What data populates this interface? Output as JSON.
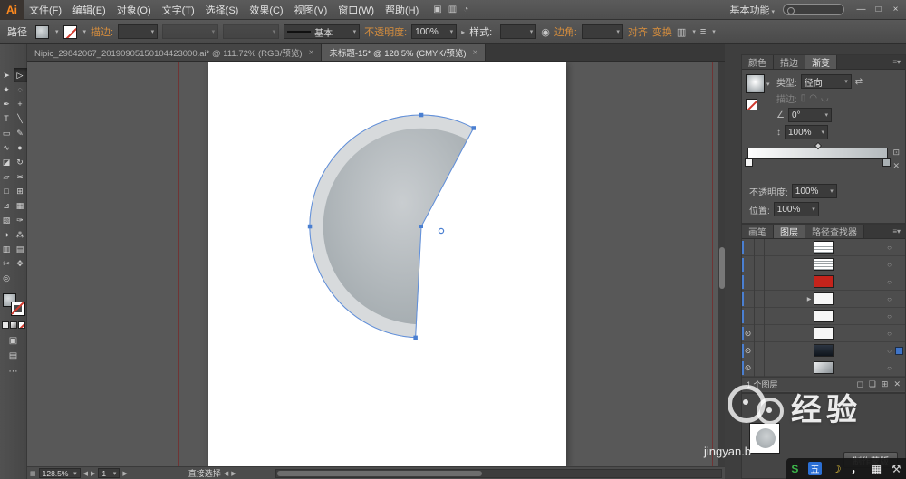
{
  "colors": {
    "accent_link": "#d78e3d",
    "selection_blue": "#4a7fd1",
    "artboard": "#ffffff"
  },
  "window": {
    "controls": [
      {
        "name": "minimize-button",
        "glyph": "—"
      },
      {
        "name": "restore-button",
        "glyph": "□"
      },
      {
        "name": "close-button",
        "glyph": "×"
      }
    ]
  },
  "menubar": {
    "logo": "Ai",
    "items": [
      "文件(F)",
      "编辑(E)",
      "对象(O)",
      "文字(T)",
      "选择(S)",
      "效果(C)",
      "视图(V)",
      "窗口(W)",
      "帮助(H)"
    ],
    "icons": [
      {
        "name": "bridge-icon",
        "glyph": "▣"
      },
      {
        "name": "arrange-documents-icon",
        "glyph": "▥"
      },
      {
        "name": "cs-live-icon",
        "glyph": "◔"
      }
    ],
    "workspace": "基本功能"
  },
  "controlbar": {
    "selection_label": "路径",
    "stroke_link": "描边:",
    "stroke_style": "基本",
    "opacity_link": "不透明度:",
    "opacity_value": "100%",
    "style_label": "样式:",
    "corner_link": "边角:",
    "align_link": "对齐",
    "transform_link": "变换"
  },
  "doc_tabs": [
    {
      "label": "Nipic_29842067_20190905150104423000.ai* @ 111.72% (RGB/预览)",
      "close": "×",
      "active": false
    },
    {
      "label": "未标题-15* @ 128.5% (CMYK/预览)",
      "close": "×",
      "active": true
    }
  ],
  "toolbar": {
    "tools": [
      {
        "name": "selection-tool",
        "glyph": "➤"
      },
      {
        "name": "direct-selection-tool",
        "glyph": "▷",
        "active": true
      },
      {
        "name": "magic-wand-tool",
        "glyph": "✦"
      },
      {
        "name": "lasso-tool",
        "glyph": "◌"
      },
      {
        "name": "pen-tool",
        "glyph": "✒"
      },
      {
        "name": "anchor-point-tool",
        "glyph": "+"
      },
      {
        "name": "type-tool",
        "glyph": "T"
      },
      {
        "name": "line-segment-tool",
        "glyph": "╲"
      },
      {
        "name": "rectangle-tool",
        "glyph": "▭"
      },
      {
        "name": "paintbrush-tool",
        "glyph": "✎"
      },
      {
        "name": "pencil-tool",
        "glyph": "∿"
      },
      {
        "name": "blob-brush-tool",
        "glyph": "●"
      },
      {
        "name": "eraser-tool",
        "glyph": "◪"
      },
      {
        "name": "rotate-tool",
        "glyph": "↻"
      },
      {
        "name": "scale-tool",
        "glyph": "▱"
      },
      {
        "name": "width-tool",
        "glyph": "≍"
      },
      {
        "name": "free-transform-tool",
        "glyph": "□"
      },
      {
        "name": "shape-builder-tool",
        "glyph": "⊞"
      },
      {
        "name": "perspective-grid-tool",
        "glyph": "⊿"
      },
      {
        "name": "mesh-tool",
        "glyph": "▦"
      },
      {
        "name": "gradient-tool",
        "glyph": "▧"
      },
      {
        "name": "eyedropper-tool",
        "glyph": "✑"
      },
      {
        "name": "blend-tool",
        "glyph": "◑"
      },
      {
        "name": "symbol-sprayer-tool",
        "glyph": "⁂"
      },
      {
        "name": "column-graph-tool",
        "glyph": "▥"
      },
      {
        "name": "artboard-tool",
        "glyph": "▤"
      },
      {
        "name": "slice-tool",
        "glyph": "✂"
      },
      {
        "name": "hand-tool",
        "glyph": "✥"
      },
      {
        "name": "zoom-tool",
        "glyph": "◎"
      }
    ],
    "extras": [
      {
        "name": "draw-mode-button",
        "glyph": "▣"
      },
      {
        "name": "change-screen-mode-button",
        "glyph": "▤"
      },
      {
        "name": "ellipsis-icon",
        "glyph": "⋯"
      }
    ]
  },
  "gradient_panel": {
    "tabs": [
      {
        "label": "颜色"
      },
      {
        "label": "描边"
      },
      {
        "label": "渐变",
        "active": true
      }
    ],
    "type_label": "类型:",
    "type_value": "径向",
    "stroke_label": "描边:",
    "angle_value": "0°",
    "aspect_value": "100%",
    "opacity_label": "不透明度:",
    "opacity_value": "100%",
    "position_label": "位置:",
    "position_value": "100%"
  },
  "layers_panel": {
    "tabs": [
      {
        "label": "画笔"
      },
      {
        "label": "图层",
        "active": true
      },
      {
        "label": "路径查找器"
      }
    ],
    "eye_glyph": "⊙",
    "expand_glyph": "▶",
    "target_glyph": "○",
    "rows": [
      {
        "thumb": "stripes",
        "eye": false,
        "expand": false,
        "selected": false
      },
      {
        "thumb": "stripes",
        "eye": false,
        "expand": false,
        "selected": false
      },
      {
        "thumb": "red",
        "eye": false,
        "expand": false,
        "selected": false
      },
      {
        "thumb": "white",
        "eye": false,
        "expand": true,
        "selected": false
      },
      {
        "thumb": "white",
        "eye": false,
        "expand": false,
        "selected": false
      },
      {
        "thumb": "white",
        "eye": true,
        "expand": false,
        "selected": false
      },
      {
        "thumb": "dark",
        "eye": true,
        "expand": false,
        "selected": true
      },
      {
        "thumb": "grad",
        "eye": true,
        "expand": false,
        "selected": false
      }
    ],
    "footer_status": "1 个图层",
    "footer_icons": [
      {
        "name": "make-clip-mask-icon",
        "glyph": "◻"
      },
      {
        "name": "new-sublayer-icon",
        "glyph": "❏"
      },
      {
        "name": "new-layer-icon",
        "glyph": "⊞"
      },
      {
        "name": "delete-layer-icon",
        "glyph": "✕"
      }
    ]
  },
  "transparency_panel": {
    "make_mask_label": "制作蒙版"
  },
  "statusbar": {
    "zoom": "128.5%",
    "page": "1",
    "tool_label": "直接选择"
  },
  "watermark": {
    "title": "经验",
    "subtitle": "jingyan.b"
  },
  "ime": {
    "icons": [
      {
        "name": "sogou-icon",
        "glyph": "S",
        "color": "#3cb54a"
      },
      {
        "name": "wubi-icon",
        "glyph": "五",
        "color": "#ffffff",
        "bg": "#2b6fd4"
      },
      {
        "name": "moon-icon",
        "glyph": "☽",
        "color": "#e8c63d"
      },
      {
        "name": "punctuation-icon",
        "glyph": "，",
        "color": "#ffffff"
      },
      {
        "name": "soft-keyboard-icon",
        "glyph": "▦",
        "color": "#ffffff"
      },
      {
        "name": "toolbox-icon",
        "glyph": "⚒",
        "color": "#cfcfcf"
      }
    ]
  }
}
